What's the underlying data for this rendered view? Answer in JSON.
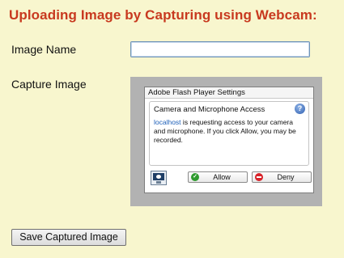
{
  "page": {
    "title": "Uploading Image by Capturing using Webcam:"
  },
  "form": {
    "image_name_label": "Image Name",
    "image_name_value": "",
    "capture_label": "Capture Image",
    "save_button_label": "Save Captured Image"
  },
  "flash_dialog": {
    "title": "Adobe Flash Player Settings",
    "heading": "Camera and Microphone Access",
    "help_icon": "help-icon",
    "message_link": "localhost",
    "message_text": " is requesting access to your camera and microphone. If you click Allow, you may be recorded.",
    "camera_icon": "camera-icon",
    "allow_label": "Allow",
    "deny_label": "Deny",
    "allow_icon": "check-icon",
    "deny_icon": "deny-icon"
  },
  "colors": {
    "background": "#f8f6ce",
    "title": "#c8391f",
    "webcam_frame": "#b2b2b2",
    "link": "#1d5fb8"
  }
}
